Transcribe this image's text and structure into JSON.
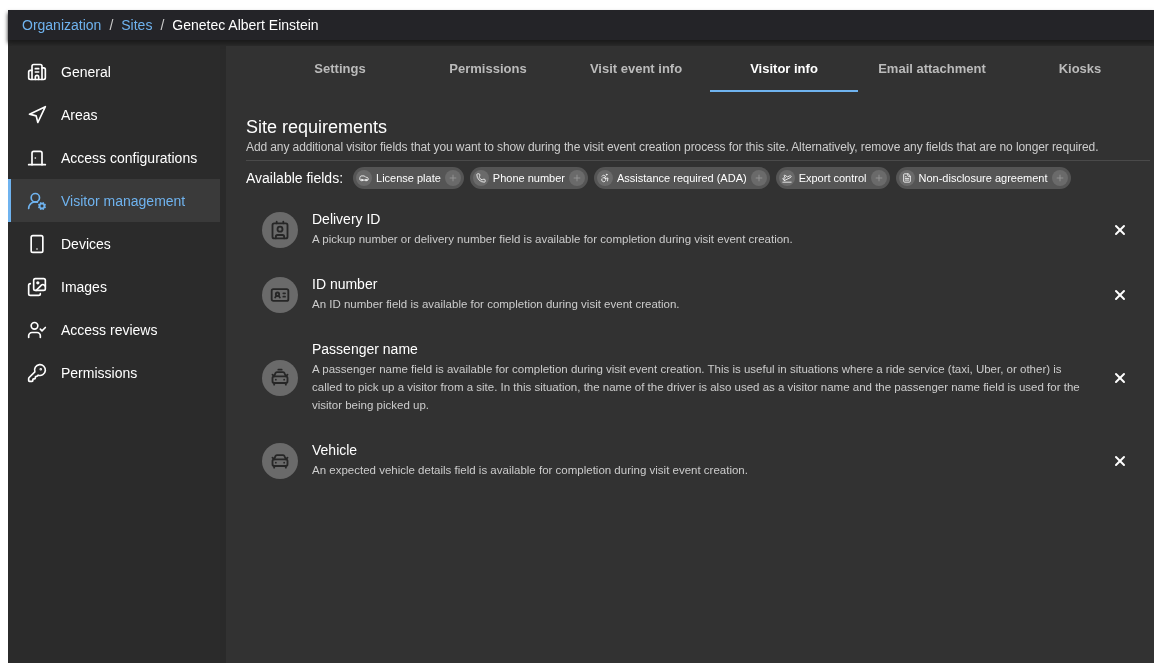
{
  "breadcrumb": [
    {
      "kind": "link",
      "label": "Organization"
    },
    {
      "kind": "separator",
      "label": "/"
    },
    {
      "kind": "link",
      "label": "Sites"
    },
    {
      "kind": "separator",
      "label": "/"
    },
    {
      "kind": "current",
      "label": "Genetec Albert Einstein"
    }
  ],
  "sidebar": {
    "items": [
      {
        "label": "General",
        "selected": false
      },
      {
        "label": "Areas",
        "selected": false
      },
      {
        "label": "Access configurations",
        "selected": false
      },
      {
        "label": "Visitor management",
        "selected": true
      },
      {
        "label": "Devices",
        "selected": false
      },
      {
        "label": "Images",
        "selected": false
      },
      {
        "label": "Access reviews",
        "selected": false
      },
      {
        "label": "Permissions",
        "selected": false
      }
    ]
  },
  "tabs": [
    {
      "label": "Settings",
      "selected": false
    },
    {
      "label": "Permissions",
      "selected": false
    },
    {
      "label": "Visit event info",
      "selected": false
    },
    {
      "label": "Visitor info",
      "selected": true
    },
    {
      "label": "Email attachment",
      "selected": false
    },
    {
      "label": "Kiosks",
      "selected": false
    }
  ],
  "section": {
    "title": "Site requirements",
    "description": "Add any additional visitor fields that you want to show during the visit event creation process for this site. Alternatively, remove any fields that are no longer required."
  },
  "available_fields": {
    "label": "Available fields:",
    "chips": [
      "License plate",
      "Phone number",
      "Assistance required (ADA)",
      "Export control",
      "Non-disclosure agreement"
    ]
  },
  "fields": [
    {
      "name": "Delivery ID",
      "description": "A pickup number or delivery number field is available for completion during visit event creation."
    },
    {
      "name": "ID number",
      "description": "An ID number field is available for completion during visit event creation."
    },
    {
      "name": "Passenger name",
      "description": "A passenger name field is available for completion during visit event creation. This is useful in situations where a ride service (taxi, Uber, or other) is called to pick up a visitor from a site. In this situation, the name of the driver is also used as a visitor name and the passenger name field is used for the visitor being picked up."
    },
    {
      "name": "Vehicle",
      "description": "An expected vehicle details field is available for completion during visit event creation."
    }
  ]
}
